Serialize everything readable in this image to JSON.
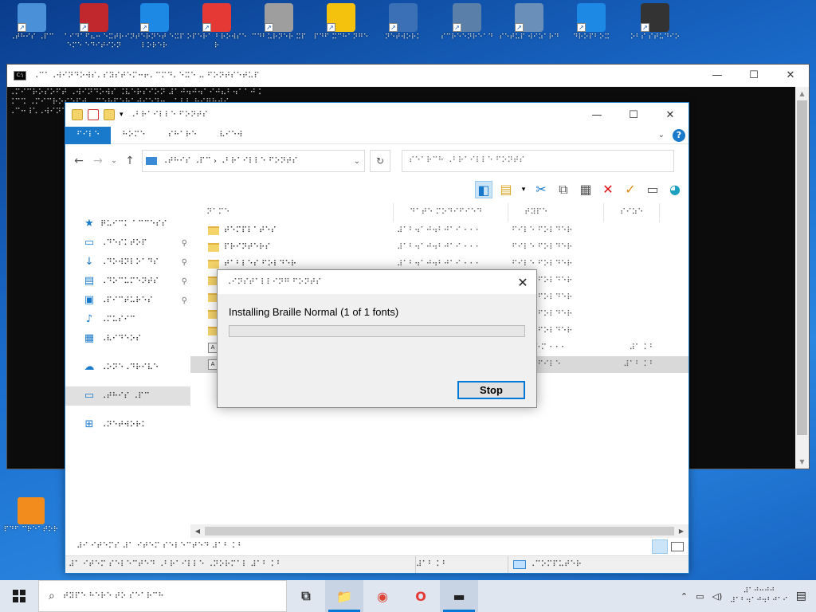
{
  "desktop": {
    "icons": [
      {
        "icon": "laptop-icon",
        "label": "⠠⠞⠓⠊⠎ ⠠⠏⠉"
      },
      {
        "icon": "aida64-icon",
        "label": "⠁⠊⠙⠁⠋⠦⠒ ⠑⠭⠞⠗⠑⠍⠑ ⠑⠙⠊⠞⠊⠕⠝"
      },
      {
        "icon": "internet-explorer-icon",
        "label": "⠊⠝⠞⠑⠗⠝⠑⠞ ⠑⠭⠏⠇⠕⠗⠑⠗"
      },
      {
        "icon": "opera-icon",
        "label": "⠕⠏⠑⠗⠁ ⠃⠗⠕⠺⠎⠑⠗"
      },
      {
        "icon": "cd-burner-icon",
        "label": "⠉⠙⠃⠥⠗⠝⠑⠗ ⠭⠏"
      },
      {
        "icon": "pdf-reader-icon",
        "label": "⠏⠙⠋ ⠭⠉⠓⠁⠝⠛⠑"
      },
      {
        "icon": "network-tool-icon",
        "label": "⠝⠑⠞⠺⠕⠗⠅"
      },
      {
        "icon": "glasses-icon",
        "label": "⠎⠉⠗⠑⠑⠝⠗⠑⠁⠙"
      },
      {
        "icon": "user-setup-icon",
        "label": "⠎⠑⠞⠥⠏ ⠺⠊⠵⠁⠗⠙"
      },
      {
        "icon": "dropbox-icon",
        "label": "⠙⠗⠕⠏⠃⠕⠭"
      },
      {
        "icon": "obs-icon",
        "label": "⠕⠃⠎ ⠎⠞⠥⠙⠊⠕"
      }
    ],
    "pdf_icon": {
      "icon": "pdf-creator-icon",
      "label": "⠏⠙⠋ ⠉⠗⠑⠁⠞⠕⠗"
    }
  },
  "cmd_window": {
    "title": "⠠⠉⠁⠠⠺⠊⠝⠙⠕⠺⠎⠄⠎⠽⠎⠞⠑⠍⠒⠖⠄⠉⠍⠙⠄⠑⠭⠑ ⠤ ⠋⠕⠝⠞⠎⠑⠞⠥⠏",
    "lines": [
      "⠠⠍⠊⠉⠗⠕⠎⠕⠋⠞ ⠠⠺⠊⠝⠙⠕⠺⠎ ⠨⠧⠑⠗⠎⠊⠕⠝ ⠼⠁⠚⠲⠚⠲⠁⠊⠚⠦⠃⠲⠁⠁⠚⠨",
      "⠨⠉⠩ ⠠⠍⠊⠉⠗⠕⠎⠕⠋⠞ ⠠⠉⠕⠗⠏⠕⠗⠁⠞⠊⠕⠝⠲ ⠠⠁⠇⠇ ⠗⠊⠛⠓⠞⠎",
      "",
      "⠠⠉⠒⠸⠡⠠⠺⠊⠝⠙⠕⠺⠎⠸⠡⠋⠕⠝⠞⠎⠨"
    ],
    "minimize": "—",
    "maximize": "☐",
    "close": "✕"
  },
  "explorer": {
    "title": "⠠⠃⠗⠁⠊⠇⠇⠑ ⠋⠕⠝⠞⠎",
    "ribbon_tabs": [
      "⠋⠊⠇⠑",
      "⠓⠕⠍⠑",
      "⠎⠓⠁⠗⠑",
      "⠧⠊⠑⠺"
    ],
    "help": "?",
    "address_path": "⠠⠞⠓⠊⠎ ⠠⠏⠉ › ⠠⠃⠗⠁⠊⠇⠇⠑ ⠋⠕⠝⠞⠎",
    "address_prefix": "›",
    "search_placeholder": "⠎⠑⠁⠗⠉⠓ ⠠⠃⠗⠁⠊⠇⠇⠑ ⠋⠕⠝⠞⠎",
    "minimize": "—",
    "maximize": "☐",
    "close": "✕",
    "columns": [
      "⠝⠁⠍⠑",
      "⠙⠁⠞⠑ ⠍⠕⠙⠊⠋⠊⠑⠙",
      "⠞⠽⠏⠑",
      "⠎⠊⠵⠑"
    ],
    "nav_items": [
      {
        "icon": "star-icon",
        "label": "⠟⠥⠊⠉⠅ ⠁⠉⠉⠑⠎⠎",
        "pinned": false,
        "glyph": "★"
      },
      {
        "icon": "desktop-icon",
        "label": "⠠⠙⠑⠎⠅⠞⠕⠏",
        "pinned": true,
        "glyph": "▭"
      },
      {
        "icon": "download-icon",
        "label": "⠠⠙⠕⠺⠝⠇⠕⠁⠙⠎",
        "pinned": true,
        "glyph": "↓"
      },
      {
        "icon": "document-icon",
        "label": "⠠⠙⠕⠉⠥⠍⠑⠝⠞⠎",
        "pinned": true,
        "glyph": "▤"
      },
      {
        "icon": "pictures-icon",
        "label": "⠠⠏⠊⠉⠞⠥⠗⠑⠎",
        "pinned": true,
        "glyph": "▣"
      },
      {
        "icon": "music-icon",
        "label": "⠠⠍⠥⠎⠊⠉",
        "pinned": false,
        "glyph": "♪"
      },
      {
        "icon": "video-icon",
        "label": "⠠⠧⠊⠙⠑⠕⠎",
        "pinned": false,
        "glyph": "▦"
      },
      {
        "icon": "onedrive-icon",
        "label": "⠠⠕⠝⠑⠠⠙⠗⠊⠧⠑",
        "pinned": false,
        "glyph": "☁"
      },
      {
        "icon": "this-pc-icon",
        "label": "⠠⠞⠓⠊⠎ ⠠⠏⠉",
        "pinned": false,
        "glyph": "▭"
      },
      {
        "icon": "network-icon",
        "label": "⠠⠝⠑⠞⠺⠕⠗⠅",
        "pinned": false,
        "glyph": "⊞"
      }
    ],
    "rows": [
      {
        "kind": "folder",
        "name": "⠞⠑⠍⠏⠇⠁⠞⠑⠎",
        "date": "⠼⠁⠃⠲⠁⠚⠲⠃⠚⠁⠊ ⠂⠂⠂",
        "type": "⠋⠊⠇⠑ ⠋⠕⠇⠙⠑⠗",
        "size": ""
      },
      {
        "kind": "folder",
        "name": "⠏⠗⠊⠝⠞⠑⠗⠎",
        "date": "⠼⠁⠃⠲⠁⠚⠲⠃⠚⠁⠊ ⠂⠂⠂",
        "type": "⠋⠊⠇⠑ ⠋⠕⠇⠙⠑⠗",
        "size": ""
      },
      {
        "kind": "folder",
        "name": "⠞⠁⠃⠇⠑⠎ ⠋⠕⠇⠙⠑⠗",
        "date": "⠼⠁⠃⠲⠁⠚⠲⠃⠚⠁⠊ ⠂⠂⠂",
        "type": "⠋⠊⠇⠑ ⠋⠕⠇⠙⠑⠗",
        "size": ""
      },
      {
        "kind": "folder",
        "name": "",
        "date": "",
        "type": "⠋⠊⠇⠑ ⠋⠕⠇⠙⠑⠗",
        "size": ""
      },
      {
        "kind": "folder",
        "name": "",
        "date": "",
        "type": "⠋⠊⠇⠑ ⠋⠕⠇⠙⠑⠗",
        "size": ""
      },
      {
        "kind": "folder",
        "name": "",
        "date": "",
        "type": "⠋⠊⠇⠑ ⠋⠕⠇⠙⠑⠗",
        "size": ""
      },
      {
        "kind": "folder",
        "name": "",
        "date": "",
        "type": "⠋⠊⠇⠑ ⠋⠕⠇⠙⠑⠗",
        "size": ""
      },
      {
        "kind": "file",
        "name": "",
        "date": "",
        "type": "⠎⠽⠎⠞⠑⠍ ⠂⠂⠂",
        "size": "⠼⠁ ⠅⠃"
      },
      {
        "kind": "file-selected",
        "name": "",
        "date": "",
        "type": "⠋⠕⠝⠞ ⠋⠊⠇⠑",
        "size": "⠼⠁⠃ ⠅⠃"
      }
    ],
    "status_text": "⠼⠊ ⠊⠞⠑⠍⠎  ⠼⠁ ⠊⠞⠑⠍ ⠎⠑⠇⠑⠉⠞⠑⠙ ⠼⠁⠃ ⠅⠃",
    "details_left": "⠼⠁ ⠊⠞⠑⠍ ⠎⠑⠇⠑⠉⠞⠑⠙ ⠠⠃⠗⠁⠊⠇⠇⠑ ⠠⠝⠕⠗⠍⠁⠇ ⠼⠁⠃ ⠅⠃",
    "details_mid": "⠼⠁⠃ ⠅⠃",
    "details_right": "⠠⠉⠕⠍⠏⠥⠞⠑⠗"
  },
  "dialog": {
    "title": "⠠⠊⠝⠎⠞⠁⠇⠇⠊⠝⠛ ⠋⠕⠝⠞⠎",
    "close": "✕",
    "message": "Installing Braille Normal (1 of 1 fonts)",
    "progress": 0.0,
    "stop_label": "Stop"
  },
  "taskbar": {
    "search_placeholder": "⠞⠽⠏⠑ ⠓⠑⠗⠑ ⠞⠕ ⠎⠑⠁⠗⠉⠓",
    "apps": [
      {
        "icon": "task-view-icon",
        "glyph": "⧉",
        "active": false
      },
      {
        "icon": "file-explorer-icon",
        "glyph": "📁",
        "active": true
      },
      {
        "icon": "chrome-icon",
        "glyph": "◉",
        "active": false
      },
      {
        "icon": "opera-taskbar-icon",
        "glyph": "O",
        "active": false
      },
      {
        "icon": "cmd-taskbar-icon",
        "glyph": "▬",
        "active": true
      }
    ],
    "tray_up": "⌃",
    "clock_time": "⠼⠁⠚⠒⠚⠚",
    "clock_date": "⠼⠁⠃⠲⠁⠚⠲⠃⠚⠁⠊",
    "notification": "▤"
  },
  "colors": {
    "accent": "#1979ca",
    "progress_fill": "#06b025",
    "desktop": "#1a6ccc"
  }
}
